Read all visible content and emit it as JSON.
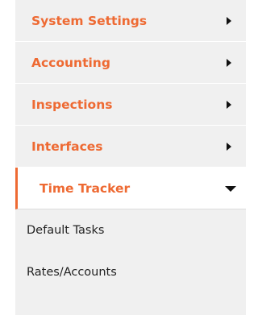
{
  "menu": {
    "items": [
      {
        "label": "System Settings",
        "icon": "chevron-right-icon"
      },
      {
        "label": "Accounting",
        "icon": "chevron-right-icon"
      },
      {
        "label": "Inspections",
        "icon": "chevron-right-icon"
      },
      {
        "label": "Interfaces",
        "icon": "chevron-right-icon"
      },
      {
        "label": "Time Tracker",
        "icon": "chevron-down-icon",
        "expanded": true
      }
    ],
    "submenu": [
      {
        "label": "Default Tasks"
      },
      {
        "label": "Rates/Accounts"
      }
    ]
  },
  "colors": {
    "accent": "#ee6a33",
    "menu_bg": "#f0f0f0",
    "active_bg": "#ffffff",
    "text": "#222222"
  }
}
